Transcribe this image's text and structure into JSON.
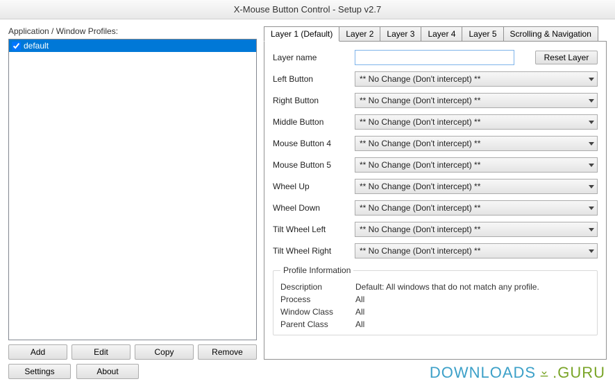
{
  "window": {
    "title": "X-Mouse Button Control - Setup v2.7"
  },
  "profiles": {
    "label": "Application / Window Profiles:",
    "items": [
      {
        "name": "default",
        "checked": true
      }
    ],
    "buttons": {
      "add": "Add",
      "edit": "Edit",
      "copy": "Copy",
      "remove": "Remove"
    }
  },
  "tabs": [
    "Layer 1 (Default)",
    "Layer 2",
    "Layer 3",
    "Layer 4",
    "Layer 5",
    "Scrolling & Navigation"
  ],
  "layer": {
    "nameLabel": "Layer name",
    "nameValue": "",
    "resetLabel": "Reset Layer",
    "rows": [
      {
        "label": "Left Button",
        "value": "** No Change (Don't intercept) **"
      },
      {
        "label": "Right Button",
        "value": "** No Change (Don't intercept) **"
      },
      {
        "label": "Middle Button",
        "value": "** No Change (Don't intercept) **"
      },
      {
        "label": "Mouse Button 4",
        "value": "** No Change (Don't intercept) **"
      },
      {
        "label": "Mouse Button 5",
        "value": "** No Change (Don't intercept) **"
      },
      {
        "label": "Wheel Up",
        "value": "** No Change (Don't intercept) **"
      },
      {
        "label": "Wheel Down",
        "value": "** No Change (Don't intercept) **"
      },
      {
        "label": "Tilt Wheel Left",
        "value": "** No Change (Don't intercept) **"
      },
      {
        "label": "Tilt Wheel Right",
        "value": "** No Change (Don't intercept) **"
      }
    ]
  },
  "profileInfo": {
    "title": "Profile Information",
    "rows": [
      {
        "label": "Description",
        "value": "Default: All windows that do not match any profile."
      },
      {
        "label": "Process",
        "value": "All"
      },
      {
        "label": "Window Class",
        "value": "All"
      },
      {
        "label": "Parent Class",
        "value": "All"
      }
    ]
  },
  "footer": {
    "settings": "Settings",
    "about": "About"
  },
  "watermark": {
    "a": "DOWNLOADS",
    "b": ".GURU"
  }
}
